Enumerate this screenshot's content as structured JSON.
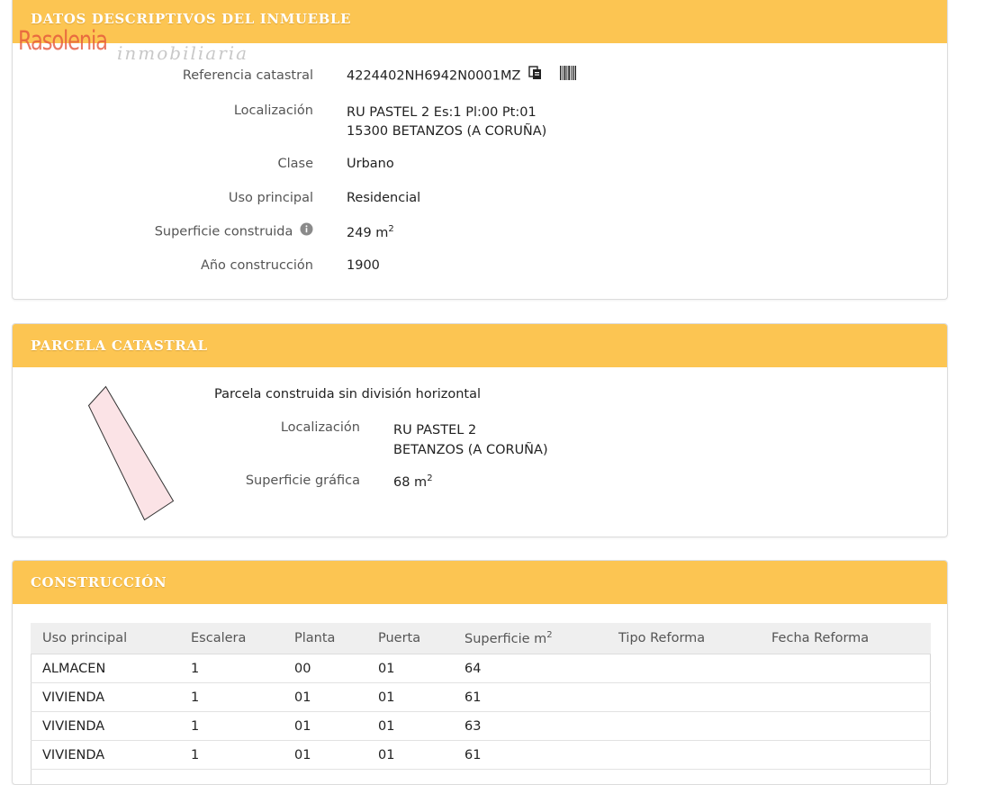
{
  "logo": {
    "main": "Rasolenia",
    "sub": "inmobiliaria"
  },
  "inmueble": {
    "title": "DATOS DESCRIPTIVOS DEL INMUEBLE",
    "referencia_label": "Referencia catastral",
    "referencia_value": "4224402NH6942N0001MZ",
    "localizacion_label": "Localización",
    "localizacion_line1": "RU PASTEL 2 Es:1 Pl:00 Pt:01",
    "localizacion_line2": "15300 BETANZOS (A CORUÑA)",
    "clase_label": "Clase",
    "clase_value": "Urbano",
    "uso_label": "Uso principal",
    "uso_value": "Residencial",
    "superficie_label": "Superficie construida",
    "superficie_value": "249 m",
    "superficie_unit_exp": "2",
    "anio_label": "Año construcción",
    "anio_value": "1900"
  },
  "parcela": {
    "title": "PARCELA CATASTRAL",
    "description": "Parcela construida sin división horizontal",
    "localizacion_label": "Localización",
    "localizacion_line1": "RU PASTEL 2",
    "localizacion_line2": "BETANZOS (A CORUÑA)",
    "superficie_label": "Superficie gráfica",
    "superficie_value": "68 m",
    "superficie_unit_exp": "2"
  },
  "construccion": {
    "title": "CONSTRUCCIÓN",
    "headers": [
      "Uso principal",
      "Escalera",
      "Planta",
      "Puerta",
      "Superficie m",
      "Tipo Reforma",
      "Fecha Reforma"
    ],
    "superficie_header_exp": "2",
    "rows": [
      [
        "ALMACEN",
        "1",
        "00",
        "01",
        "64",
        "",
        ""
      ],
      [
        "VIVIENDA",
        "1",
        "01",
        "01",
        "61",
        "",
        ""
      ],
      [
        "VIVIENDA",
        "1",
        "01",
        "01",
        "63",
        "",
        ""
      ],
      [
        "VIVIENDA",
        "1",
        "01",
        "01",
        "61",
        "",
        ""
      ]
    ]
  },
  "colors": {
    "header_bg": "#fcc552",
    "header_text": "#ffffff",
    "parcel_fill": "#fbe3e6",
    "logo_red": "#e5563b"
  }
}
